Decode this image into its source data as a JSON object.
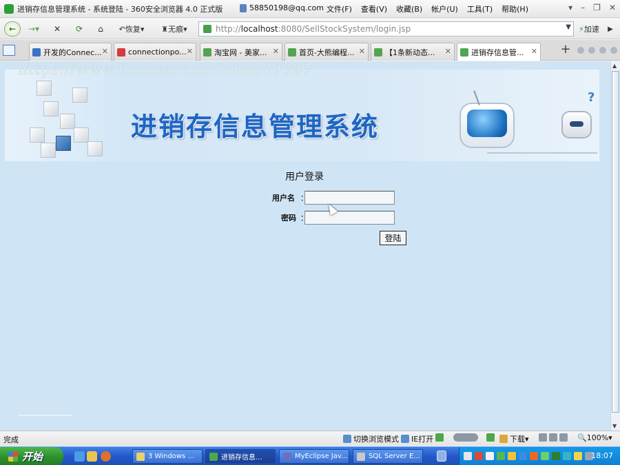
{
  "browser": {
    "window_title": "进销存信息管理系统 - 系统登陆 - 360安全浏览器 4.0 正式版",
    "account": "58850198@qq.com",
    "menus": [
      "文件(F)",
      "查看(V)",
      "收藏(B)",
      "帐户(U)",
      "工具(T)",
      "帮助(H)"
    ],
    "toolbar": {
      "restore_label": "恢复",
      "traceless_label": "无痕",
      "speed_label": "加速"
    },
    "address": {
      "prefix": "http://",
      "host": "localhost",
      "rest": ":8080/SellStockSystem/login.jsp"
    },
    "tabs": [
      {
        "label": "开发的Connec...",
        "active": false
      },
      {
        "label": "connectionpo...",
        "active": false
      },
      {
        "label": "淘宝网 - 美家...",
        "active": false
      },
      {
        "label": "首页-大熊编程...",
        "active": false
      },
      {
        "label": "【1条新动态...",
        "active": false
      },
      {
        "label": "进销存信息管...",
        "active": true
      }
    ],
    "status": {
      "text": "完成",
      "switch_mode": "切换浏览模式",
      "ie_open": "IE打开",
      "download": "下载",
      "zoom": "100%"
    }
  },
  "page": {
    "watermark": "https://www.huzhan.com/ishop39397",
    "banner_title": "进销存信息管理系统",
    "login": {
      "heading": "用户登录",
      "username_label": "用户名",
      "password_label": "密码",
      "colon": "：",
      "username_value": "",
      "password_value": "",
      "submit_label": "登陆"
    }
  },
  "taskbar": {
    "start_label": "开始",
    "tasks": [
      {
        "label": "3 Windows ...",
        "active": false
      },
      {
        "label": "进销存信息...",
        "active": true
      },
      {
        "label": "MyEclipse Jav...",
        "active": false
      },
      {
        "label": "SQL Server E...",
        "active": false
      }
    ],
    "clock": "18:07"
  },
  "colors": {
    "content_bg": "#cfe5f5",
    "banner_title": "#1e66c4",
    "taskbar": "#2559c9",
    "start": "#2e922e"
  }
}
